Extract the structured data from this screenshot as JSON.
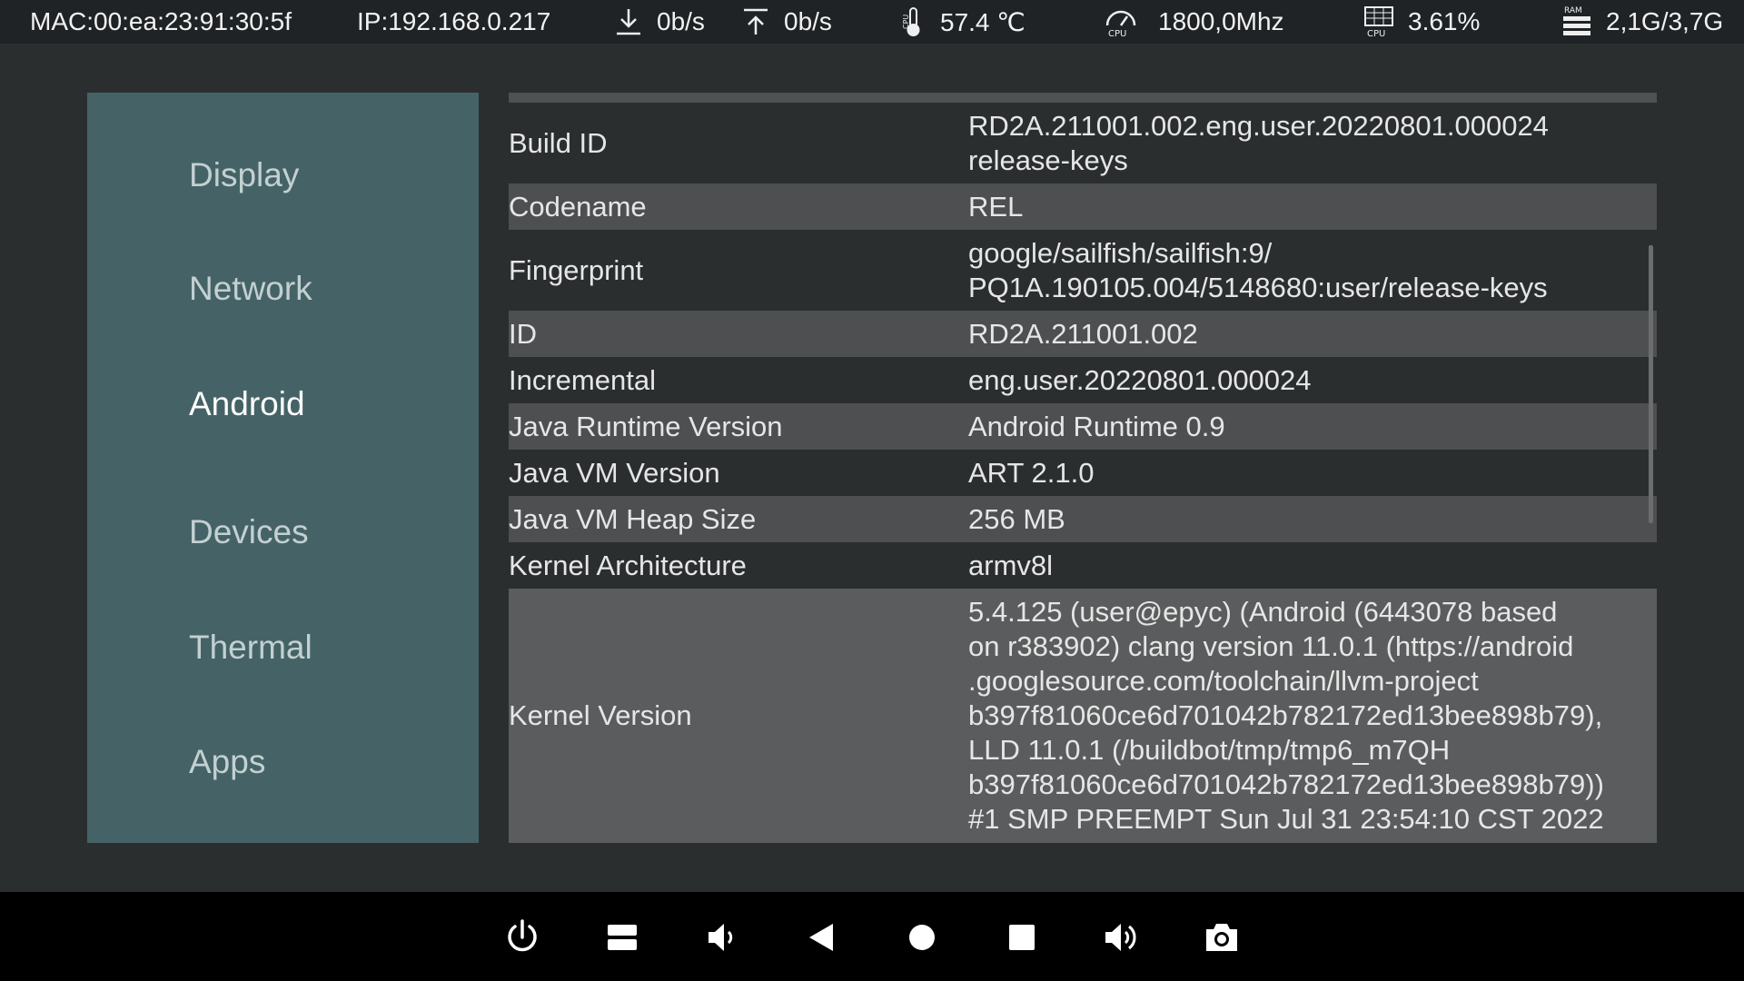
{
  "status_bar": {
    "mac": "MAC:00:ea:23:91:30:5f",
    "ip": "IP:192.168.0.217",
    "download": "0b/s",
    "upload": "0b/s",
    "temperature": "57.4 ℃",
    "cpu_freq": "1800,0Mhz",
    "cpu_usage": "3.61%",
    "ram": "2,1G/3,7G",
    "icons": [
      "download-icon",
      "upload-icon",
      "cpu-thermometer-icon",
      "cpu-gauge-icon",
      "cpu-chart-icon",
      "ram-icon"
    ]
  },
  "sidebar": {
    "items": [
      {
        "label": "Display"
      },
      {
        "label": "Network"
      },
      {
        "label": "Android"
      },
      {
        "label": "Devices"
      },
      {
        "label": "Thermal"
      },
      {
        "label": "Apps"
      }
    ],
    "active": "Android"
  },
  "table": {
    "rows": [
      {
        "key": "Build ID",
        "value": "RD2A.211001.002.eng.user.20220801.000024\nrelease-keys"
      },
      {
        "key": "Codename",
        "value": "REL"
      },
      {
        "key": "Fingerprint",
        "value": "google/sailfish/sailfish:9/\nPQ1A.190105.004/5148680:user/release-keys"
      },
      {
        "key": "ID",
        "value": "RD2A.211001.002"
      },
      {
        "key": "Incremental",
        "value": "eng.user.20220801.000024"
      },
      {
        "key": "Java Runtime Version",
        "value": "Android Runtime 0.9"
      },
      {
        "key": "Java VM Version",
        "value": "ART 2.1.0"
      },
      {
        "key": "Java VM Heap Size",
        "value": "256 MB"
      },
      {
        "key": "Kernel Architecture",
        "value": "armv8l"
      },
      {
        "key": "Kernel Version",
        "value": "5.4.125 (user@epyc) (Android (6443078 based\non r383902) clang version 11.0.1 (https://android\n.googlesource.com/toolchain/llvm-project\nb397f81060ce6d701042b782172ed13bee898b79),\nLLD 11.0.1 (/buildbot/tmp/tmp6_m7QH\nb397f81060ce6d701042b782172ed13bee898b79))\n#1 SMP PREEMPT Sun Jul 31 23:54:10 CST 2022"
      }
    ]
  },
  "nav_bar": {
    "buttons": [
      "power-icon",
      "menu-icon",
      "volume-down-icon",
      "back-icon",
      "home-icon",
      "recents-icon",
      "volume-up-icon",
      "screenshot-icon"
    ]
  },
  "colors": {
    "background": "#2b2e2f",
    "status_bar": "#1f2326",
    "sidebar": "#456367",
    "row_shaded": "#4d4f51",
    "kernel_row": "#5b5c5d",
    "nav_bar": "#000000"
  }
}
